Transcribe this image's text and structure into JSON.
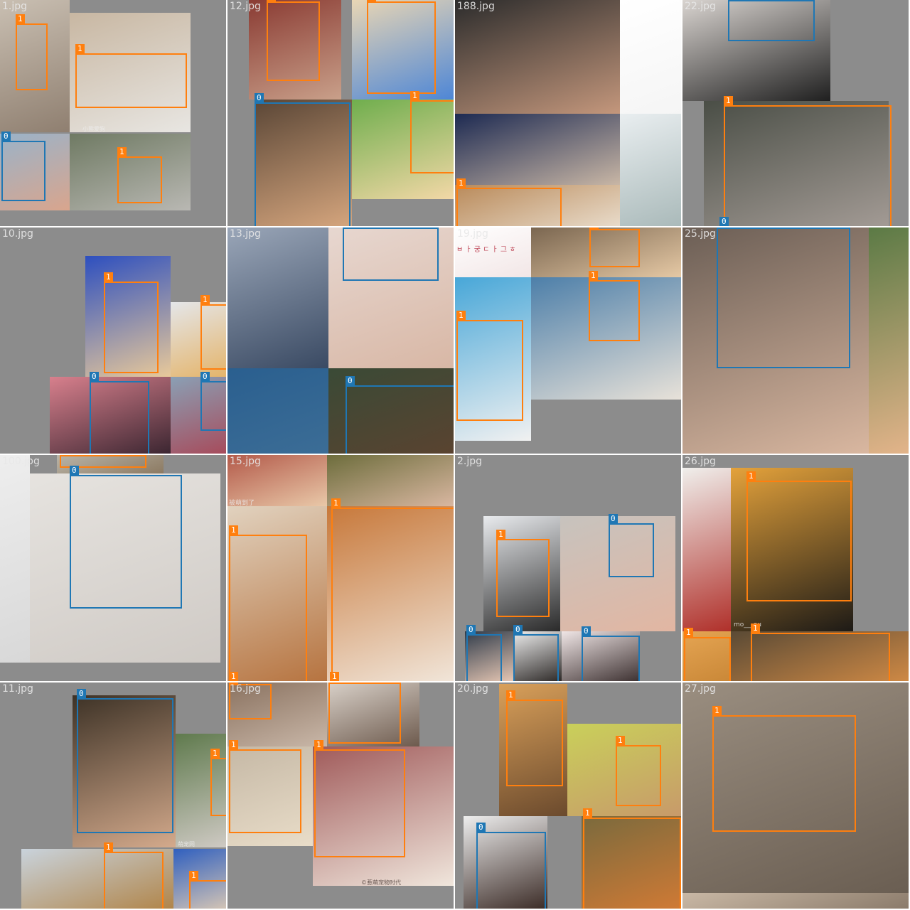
{
  "colors": {
    "tile_bg": "#8c8c8c",
    "class0": "#1f77b4",
    "class1": "#ff7f0e",
    "divider": "#ffffff"
  },
  "tiles": [
    {
      "filename": "1.jpg",
      "photos": [
        {
          "c1": "#c9bfb2",
          "c2": "#8f7f70"
        },
        {
          "c1": "#c8b7a2",
          "c2": "#e8e6e2"
        },
        {
          "c1": "#9ab3c9",
          "c2": "#d9a58d"
        },
        {
          "c1": "#6f7a63",
          "c2": "#b9b8b3"
        }
      ],
      "watermarks": [
        "小熊爱狗"
      ],
      "boxes": [
        {
          "cls": "1"
        },
        {
          "cls": "1"
        },
        {
          "cls": "0"
        },
        {
          "cls": "1"
        }
      ]
    },
    {
      "filename": "12.jpg",
      "photos": [
        {
          "c1": "#8a3b33",
          "c2": "#c9a08a"
        },
        {
          "c1": "#e9d6b4",
          "c2": "#4d86d6"
        },
        {
          "c1": "#5a4636",
          "c2": "#d6a67e"
        },
        {
          "c1": "#6fae4d",
          "c2": "#f3d8a7"
        }
      ],
      "watermarks": [],
      "boxes": [
        {
          "cls": "1"
        },
        {
          "cls": "1"
        },
        {
          "cls": "0"
        },
        {
          "cls": "1"
        }
      ]
    },
    {
      "filename": "188.jpg",
      "photos": [
        {
          "c1": "#2c2c2c",
          "c2": "#c4977c"
        },
        {
          "c1": "#1d2a52",
          "c2": "#c8b6a5"
        },
        {
          "c1": "#e9eef0",
          "c2": "#a9b9b9"
        },
        {
          "c1": "#b98a5a",
          "c2": "#e9dccb"
        },
        {
          "c1": "#ffffff",
          "c2": "#f5f5f5"
        }
      ],
      "watermarks": [],
      "boxes": [
        {
          "cls": "1"
        }
      ]
    },
    {
      "filename": "22.jpg",
      "photos": [
        {
          "c1": "#d9d4d0",
          "c2": "#1f1f1f"
        },
        {
          "c1": "#4a4e46",
          "c2": "#a39b95"
        }
      ],
      "watermarks": [],
      "boxes": [
        {
          "cls": "0"
        },
        {
          "cls": "1"
        },
        {
          "cls": "0"
        }
      ]
    },
    {
      "filename": "10.jpg",
      "photos": [
        {
          "c1": "#2d4fbf",
          "c2": "#e8c99a"
        },
        {
          "c1": "#e4e6e9",
          "c2": "#e4b46a"
        },
        {
          "c1": "#d8808d",
          "c2": "#3a2530"
        },
        {
          "c1": "#8aa0b5",
          "c2": "#a74a5a"
        }
      ],
      "watermarks": [],
      "boxes": [
        {
          "cls": "1"
        },
        {
          "cls": "1"
        },
        {
          "cls": "0"
        },
        {
          "cls": "0"
        }
      ]
    },
    {
      "filename": "13.jpg",
      "photos": [
        {
          "c1": "#9aa6b8",
          "c2": "#3a4a63"
        },
        {
          "c1": "#e7d7d0",
          "c2": "#d8b7a5"
        },
        {
          "c1": "#2a5f8f",
          "c2": "#3c6d96"
        },
        {
          "c1": "#3a4a36",
          "c2": "#5a4330"
        }
      ],
      "watermarks": [],
      "boxes": [
        {
          "cls": "0"
        },
        {
          "cls": "0"
        }
      ]
    },
    {
      "filename": "19.jpg",
      "photos": [
        {
          "c1": "#ffffff",
          "c2": "#f2e6e6"
        },
        {
          "c1": "#7a6650",
          "c2": "#e6c9a5"
        },
        {
          "c1": "#48a7d8",
          "c2": "#f1f1f1"
        },
        {
          "c1": "#4d7fa9",
          "c2": "#e8e2d9"
        }
      ],
      "watermarks": [
        "ㅂ ㅏ 궁 ㄷ ㅏ 그 ㅎ"
      ],
      "boxes": [
        {
          "cls": "1"
        },
        {
          "cls": "1"
        },
        {
          "cls": "1"
        }
      ]
    },
    {
      "filename": "25.jpg",
      "photos": [
        {
          "c1": "#6b5e55",
          "c2": "#d9b7a0"
        },
        {
          "c1": "#5b7a45",
          "c2": "#e3b48a"
        }
      ],
      "watermarks": [],
      "boxes": [
        {
          "cls": "0"
        }
      ]
    },
    {
      "filename": "100.jpg",
      "photos": [
        {
          "c1": "#b9b4a8",
          "c2": "#8c7a62"
        },
        {
          "c1": "#e6e3df",
          "c2": "#cfcac5"
        },
        {
          "c1": "#eeeeee",
          "c2": "#d8d8d8"
        }
      ],
      "watermarks": [],
      "boxes": [
        {
          "cls": "1"
        },
        {
          "cls": "0"
        }
      ]
    },
    {
      "filename": "15.jpg",
      "photos": [
        {
          "c1": "#b35a4a",
          "c2": "#e9c8a8"
        },
        {
          "c1": "#6d6d3c",
          "c2": "#d9b7a1"
        },
        {
          "c1": "#e1d2bf",
          "c2": "#b6733f"
        },
        {
          "c1": "#c7783a",
          "c2": "#f1e6da"
        }
      ],
      "watermarks": [
        "被萌到了"
      ],
      "boxes": [
        {
          "cls": "1"
        },
        {
          "cls": "1"
        },
        {
          "cls": "1"
        },
        {
          "cls": "1"
        }
      ]
    },
    {
      "filename": "2.jpg",
      "photos": [
        {
          "c1": "#e9ebee",
          "c2": "#2a2a2a"
        },
        {
          "c1": "#c7c3be",
          "c2": "#e2b6a2"
        },
        {
          "c1": "#2f3b4a",
          "c2": "#e9c9b5"
        },
        {
          "c1": "#eeeeee",
          "c2": "#2a2624"
        },
        {
          "c1": "#f0e6e6",
          "c2": "#3a2e2e"
        }
      ],
      "watermarks": [],
      "boxes": [
        {
          "cls": "1"
        },
        {
          "cls": "0"
        },
        {
          "cls": "0"
        },
        {
          "cls": "0"
        },
        {
          "cls": "0"
        }
      ]
    },
    {
      "filename": "26.jpg",
      "photos": [
        {
          "c1": "#f0efec",
          "c2": "#b0302a"
        },
        {
          "c1": "#e4a23b",
          "c2": "#1d1a16"
        },
        {
          "c1": "#e5a553",
          "c2": "#c98737"
        },
        {
          "c1": "#5a4a35",
          "c2": "#d08a45"
        }
      ],
      "watermarks": [
        "mo___ou"
      ],
      "boxes": [
        {
          "cls": "1"
        },
        {
          "cls": "1"
        },
        {
          "cls": "1"
        }
      ]
    },
    {
      "filename": "11.jpg",
      "photos": [
        {
          "c1": "#3d3226",
          "c2": "#d4aa8c"
        },
        {
          "c1": "#5f7a4d",
          "c2": "#cfcac4"
        },
        {
          "c1": "#c9d3dc",
          "c2": "#b08448"
        },
        {
          "c1": "#2f5fbf",
          "c2": "#d6c6b5"
        }
      ],
      "watermarks": [
        "萌宠网"
      ],
      "boxes": [
        {
          "cls": "0"
        },
        {
          "cls": "1"
        },
        {
          "cls": "1"
        },
        {
          "cls": "1"
        }
      ]
    },
    {
      "filename": "16.jpg",
      "photos": [
        {
          "c1": "#8a7260",
          "c2": "#c9b7a8"
        },
        {
          "c1": "#d9d1c9",
          "c2": "#6d5a4d"
        },
        {
          "c1": "#c5b8a5",
          "c2": "#e9ddc9"
        },
        {
          "c1": "#a05a5a",
          "c2": "#f0e6dc"
        }
      ],
      "watermarks": [
        "©惹萌宠物时代"
      ],
      "boxes": [
        {
          "cls": "1"
        },
        {
          "cls": "1"
        },
        {
          "cls": "1"
        },
        {
          "cls": "1"
        }
      ]
    },
    {
      "filename": "20.jpg",
      "photos": [
        {
          "c1": "#d9a05a",
          "c2": "#6b4a2d"
        },
        {
          "c1": "#c9d05a",
          "c2": "#c89a6a"
        },
        {
          "c1": "#eeeeee",
          "c2": "#3a2a25"
        },
        {
          "c1": "#7a6a3d",
          "c2": "#d07a35"
        }
      ],
      "watermarks": [],
      "boxes": [
        {
          "cls": "1"
        },
        {
          "cls": "1"
        },
        {
          "cls": "1"
        },
        {
          "cls": "0"
        }
      ]
    },
    {
      "filename": "27.jpg",
      "photos": [
        {
          "c1": "#9a8e80",
          "c2": "#6a5e52"
        },
        {
          "c1": "#c9b8a5",
          "c2": "#8a7a6a"
        }
      ],
      "watermarks": [],
      "boxes": [
        {
          "cls": "1"
        }
      ]
    }
  ]
}
